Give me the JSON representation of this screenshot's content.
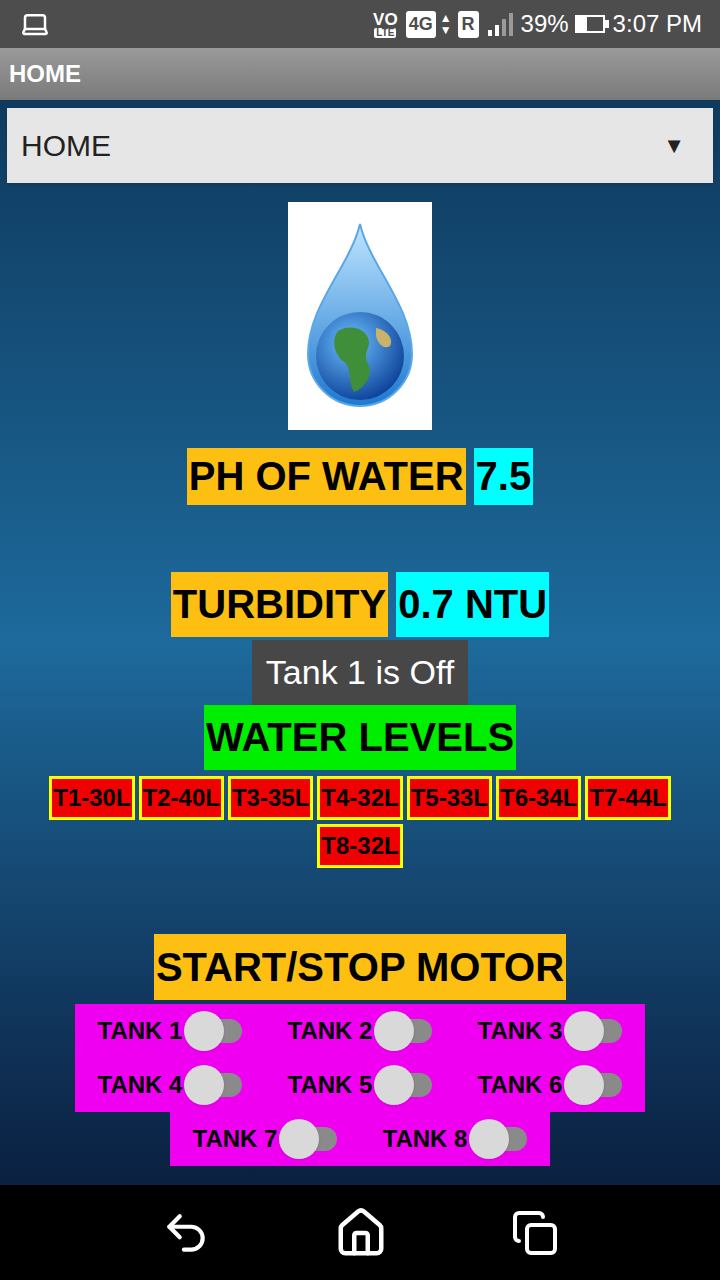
{
  "status_bar": {
    "volte": "VO",
    "lte": "LTE",
    "network": "4G",
    "roaming": "R",
    "battery": "39%",
    "battery_level": 0.39,
    "time": "3:07 PM"
  },
  "title_bar": {
    "title": "HOME"
  },
  "dropdown": {
    "value": "HOME",
    "caret": "▼"
  },
  "ph": {
    "label": "PH OF WATER",
    "value": "7.5"
  },
  "turbidity": {
    "label": "TURBIDITY",
    "value": "0.7 NTU"
  },
  "toast": "Tank 1 is Off",
  "water_levels": {
    "label": "WATER LEVELS",
    "tanks": [
      "T1-30L",
      "T2-40L",
      "T3-35L",
      "T4-32L",
      "T5-33L",
      "T6-34L",
      "T7-44L",
      "T8-32L"
    ]
  },
  "motor": {
    "label": "START/STOP MOTOR",
    "switches": [
      {
        "label": "TANK 1",
        "on": false
      },
      {
        "label": "TANK 2",
        "on": false
      },
      {
        "label": "TANK 3",
        "on": false
      },
      {
        "label": "TANK 4",
        "on": false
      },
      {
        "label": "TANK 5",
        "on": false
      },
      {
        "label": "TANK 6",
        "on": false
      },
      {
        "label": "TANK 7",
        "on": false
      },
      {
        "label": "TANK 8",
        "on": false
      }
    ]
  }
}
